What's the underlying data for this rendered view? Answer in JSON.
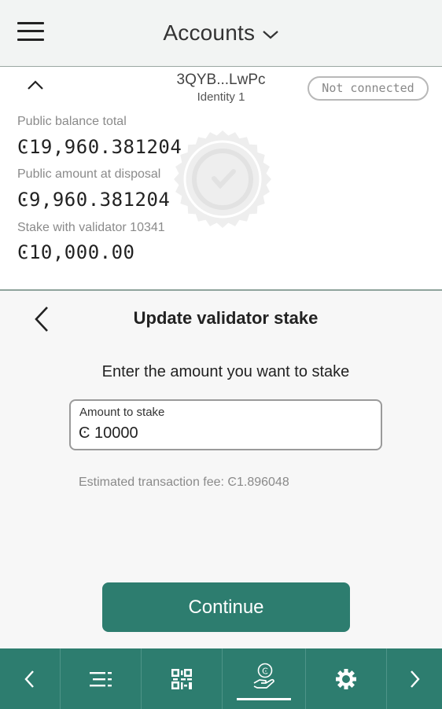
{
  "header": {
    "title": "Accounts",
    "menu_icon": "hamburger-menu-icon",
    "dropdown_icon": "chevron-down-icon"
  },
  "account": {
    "name": "3QYB...LwPc",
    "identity": "Identity 1",
    "connection_status": "Not connected",
    "public_balance_label": "Public balance total",
    "public_balance_value": "Ͼ19,960.381204",
    "disposal_label": "Public amount at disposal",
    "disposal_value": "Ͼ9,960.381204",
    "stake_label": "Stake with validator 10341",
    "stake_value": "Ͼ10,000.00"
  },
  "stake": {
    "title": "Update validator stake",
    "instruction": "Enter the amount you want to stake",
    "amount_label": "Amount to stake",
    "amount_value": "Ͼ 10000",
    "fee_text": "Estimated transaction fee: Ͼ1.896048",
    "continue_label": "Continue"
  },
  "bottom_nav": {
    "items": [
      "chevron-left-icon",
      "transactions-list-icon",
      "qr-code-icon",
      "stake-hand-coin-icon",
      "settings-gear-icon",
      "chevron-right-icon"
    ],
    "active": "stake-hand-coin-icon"
  },
  "colors": {
    "accent": "#2d7d6f",
    "header_bg": "#f2f4f3",
    "panel_bg": "#f7f7f7"
  }
}
